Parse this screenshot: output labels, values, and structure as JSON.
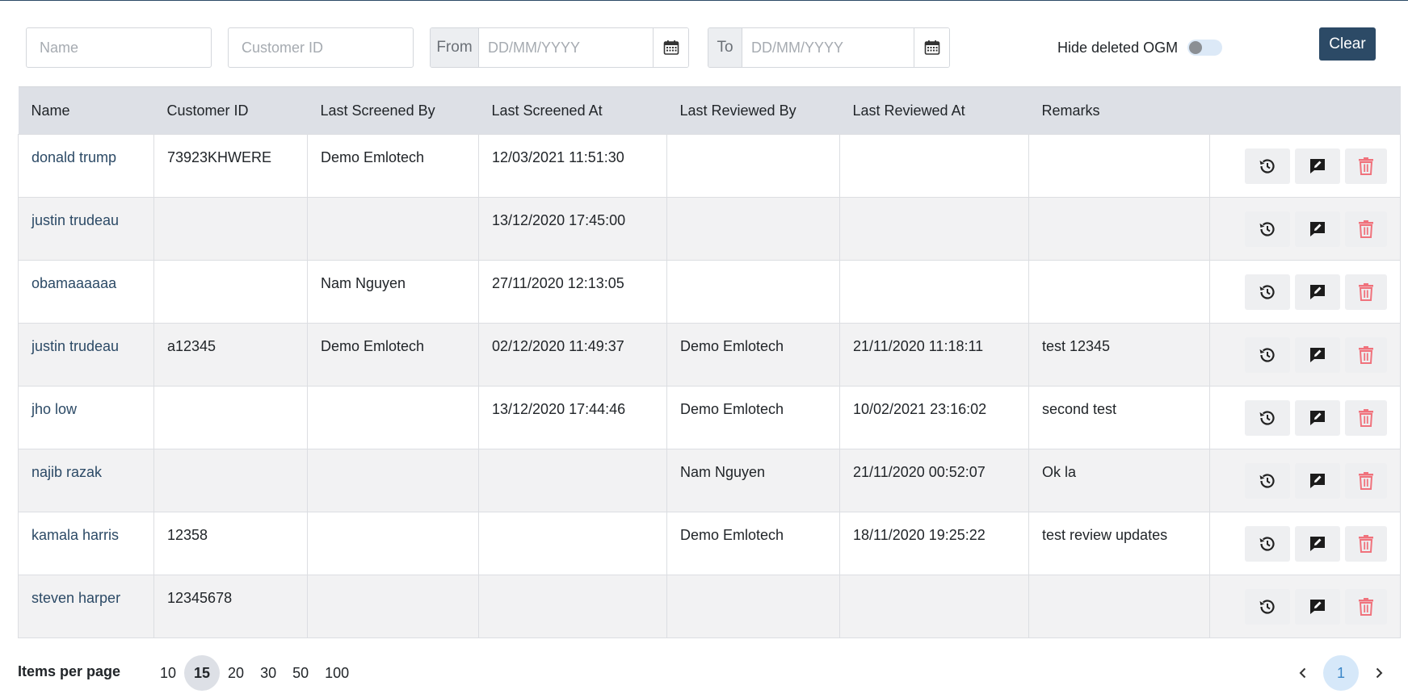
{
  "filters": {
    "name_placeholder": "Name",
    "customer_id_placeholder": "Customer ID",
    "from_label": "From",
    "from_placeholder": "DD/MM/YYYY",
    "to_label": "To",
    "to_placeholder": "DD/MM/YYYY",
    "hide_deleted_label": "Hide deleted OGM",
    "hide_deleted_on": false,
    "clear_label": "Clear"
  },
  "table": {
    "headers": [
      "Name",
      "Customer ID",
      "Last Screened By",
      "Last Screened At",
      "Last Reviewed By",
      "Last Reviewed At",
      "Remarks",
      ""
    ],
    "rows": [
      [
        "donald trump",
        "73923KHWERE",
        "Demo Emlotech",
        "12/03/2021 11:51:30",
        "",
        "",
        ""
      ],
      [
        "justin trudeau",
        "",
        "",
        "13/12/2020 17:45:00",
        "",
        "",
        ""
      ],
      [
        "obamaaaaaa",
        "",
        "Nam Nguyen",
        "27/11/2020 12:13:05",
        "",
        "",
        ""
      ],
      [
        "justin trudeau",
        "a12345",
        "Demo Emlotech",
        "02/12/2020 11:49:37",
        "Demo Emlotech",
        "21/11/2020 11:18:11",
        "test 12345"
      ],
      [
        "jho low",
        "",
        "",
        "13/12/2020 17:44:46",
        "Demo Emlotech",
        "10/02/2021 23:16:02",
        "second test"
      ],
      [
        "najib razak",
        "",
        "",
        "",
        "Nam Nguyen",
        "21/11/2020 00:52:07",
        "Ok la"
      ],
      [
        "kamala harris",
        "12358",
        "",
        "",
        "Demo Emlotech",
        "18/11/2020 19:25:22",
        "test review updates"
      ],
      [
        "steven harper",
        "12345678",
        "",
        "",
        "",
        "",
        ""
      ]
    ]
  },
  "icons": {
    "history": "history-icon",
    "review": "comment-edit-icon",
    "delete": "trash-icon",
    "calendar": "calendar-icon"
  },
  "colors": {
    "primary": "#2c4a66",
    "header_bg": "#dde0e6",
    "delete": "#f0727c",
    "page_active_bg": "#d6e8f9",
    "page_active_fg": "#3a86c8"
  },
  "pagination": {
    "items_per_page_label": "Items per page",
    "options": [
      "10",
      "15",
      "20",
      "30",
      "50",
      "100"
    ],
    "selected": "15",
    "current_page": "1"
  }
}
